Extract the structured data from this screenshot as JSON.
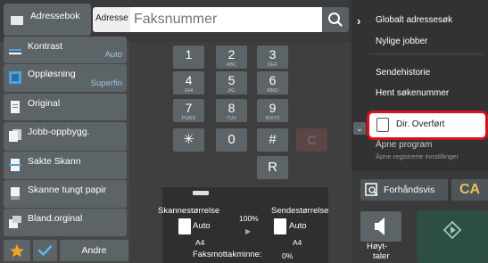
{
  "left_menu": {
    "address_book": "Adressebok",
    "items": [
      {
        "label": "Kontrast",
        "value": "Auto"
      },
      {
        "label": "Oppløsning",
        "value": "Superfin"
      },
      {
        "label": "Original",
        "value": ""
      },
      {
        "label": "Jobb-oppbygg.",
        "value": ""
      },
      {
        "label": "Sakte Skann",
        "value": ""
      },
      {
        "label": "Skanne tungt papir",
        "value": ""
      },
      {
        "label": "Bland.orginal",
        "value": ""
      }
    ],
    "other_label": "Andre"
  },
  "header": {
    "address_tab": "Adresse",
    "fax_placeholder": "Faksnummer"
  },
  "keypad": {
    "keys": [
      {
        "num": "1",
        "sub": ""
      },
      {
        "num": "2",
        "sub": "ABC"
      },
      {
        "num": "3",
        "sub": "DEF"
      },
      {
        "num": "4",
        "sub": "GHI"
      },
      {
        "num": "5",
        "sub": "JKL"
      },
      {
        "num": "6",
        "sub": "MNO"
      },
      {
        "num": "7",
        "sub": "PQRS"
      },
      {
        "num": "8",
        "sub": "TUV"
      },
      {
        "num": "9",
        "sub": "WXYZ"
      },
      {
        "num": "✳",
        "sub": ""
      },
      {
        "num": "0",
        "sub": ""
      },
      {
        "num": "#",
        "sub": ""
      }
    ],
    "clear": "C",
    "redial": "R"
  },
  "scan_info": {
    "scan_size_label": "Skannestørrelse",
    "scan_size_value": "Auto",
    "scan_paper": "A4",
    "ratio": "100%",
    "send_size_label": "Sendestørrelse",
    "send_size_value": "Auto",
    "send_paper": "A4",
    "memory_label": "Faksmottakminne:",
    "memory_value": "0%"
  },
  "right_menu": {
    "items": [
      "Globalt adressesøk",
      "Nylige jobber",
      "Sendehistorie",
      "Hent søkenummer"
    ],
    "direct_transfer": "Dir. Overført",
    "recall_program": "Åpne program",
    "recall_program_sub": "Åpne registrerte innstillinger"
  },
  "bottom_right": {
    "preview": "Forhåndsvis",
    "ca": "CA",
    "speaker_line1": "Høyt-",
    "speaker_line2": "taler"
  },
  "colors": {
    "accent_blue": "#9bc6e6",
    "highlight_red": "#d8111b",
    "ca_yellow": "#e7c05c",
    "start_green": "#2d4e45"
  }
}
